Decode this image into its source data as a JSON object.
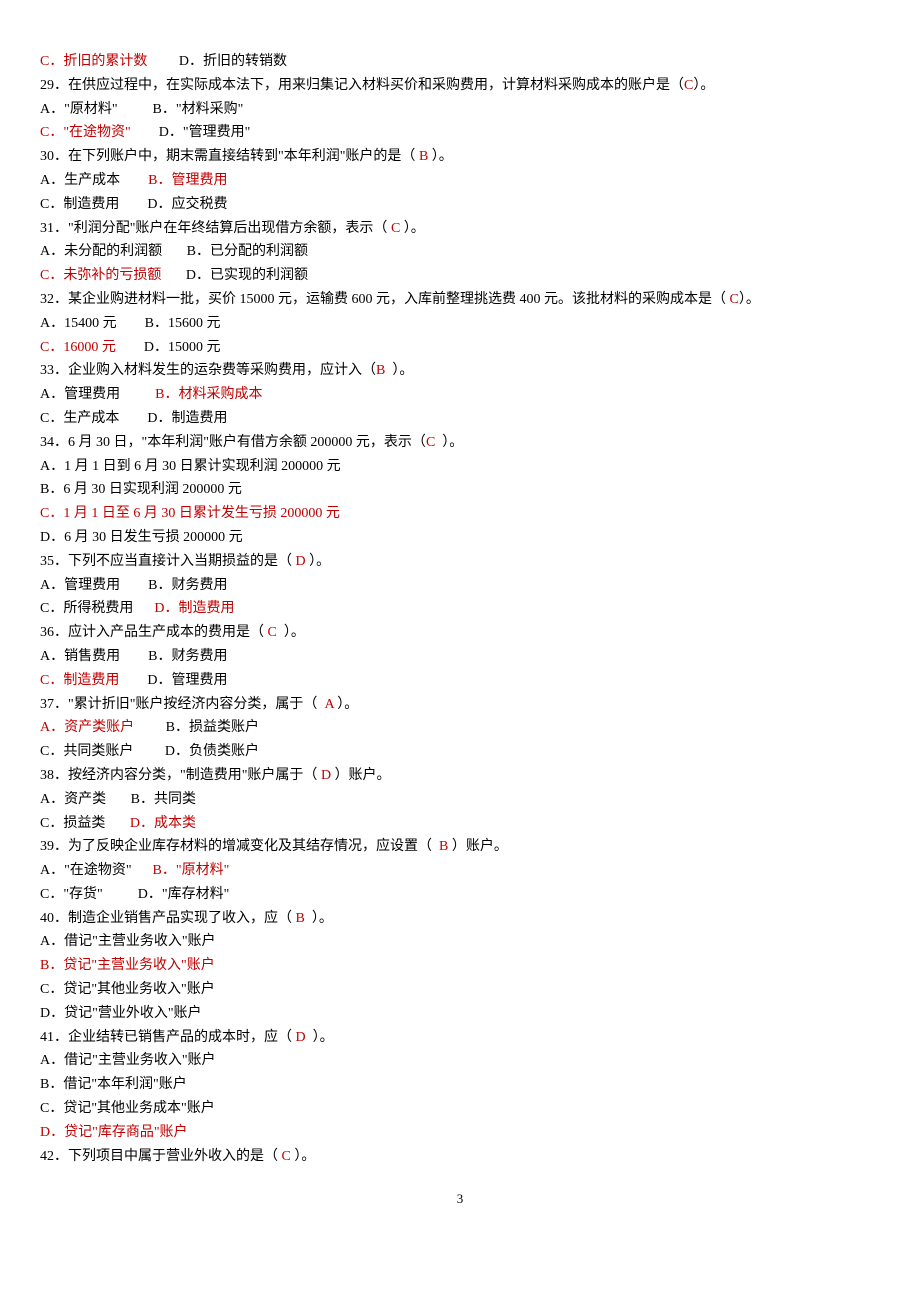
{
  "lines": [
    {
      "segments": [
        {
          "t": "C．折旧的累计数",
          "red": true
        },
        {
          "t": "         D．折旧的转销数",
          "red": false
        }
      ]
    },
    {
      "segments": [
        {
          "t": "29．在供应过程中，在实际成本法下，用来归集记入材料买价和采购费用，计算材料采购成本的账户是（",
          "red": false
        },
        {
          "t": "C",
          "red": true
        },
        {
          "t": "）。",
          "red": false
        }
      ]
    },
    {
      "segments": [
        {
          "t": "A．\"原材料\"          B．\"材料采购\"",
          "red": false
        }
      ]
    },
    {
      "segments": [
        {
          "t": "C．\"在途物资\"",
          "red": true
        },
        {
          "t": "        D．\"管理费用\"",
          "red": false
        }
      ]
    },
    {
      "segments": [
        {
          "t": "30．在下列账户中，期末需直接结转到\"本年利润\"账户的是（",
          "red": false
        },
        {
          "t": " B ",
          "red": true
        },
        {
          "t": "）。",
          "red": false
        }
      ]
    },
    {
      "segments": [
        {
          "t": "A．生产成本        ",
          "red": false
        },
        {
          "t": "B．管理费用",
          "red": true
        }
      ]
    },
    {
      "segments": [
        {
          "t": "C．制造费用        D．应交税费",
          "red": false
        }
      ]
    },
    {
      "segments": [
        {
          "t": "31．\"利润分配\"账户在年终结算后出现借方余额，表示（",
          "red": false
        },
        {
          "t": " C ",
          "red": true
        },
        {
          "t": "）。",
          "red": false
        }
      ]
    },
    {
      "segments": [
        {
          "t": "A．未分配的利润额       B．已分配的利润额",
          "red": false
        }
      ]
    },
    {
      "segments": [
        {
          "t": "C．未弥补的亏损额",
          "red": true
        },
        {
          "t": "       D．已实现的利润额",
          "red": false
        }
      ]
    },
    {
      "segments": [
        {
          "t": "32．某企业购进材料一批，买价 15000 元，运输费 600 元，入库前整理挑选费 400 元。该批材料的采购成本是（",
          "red": false
        },
        {
          "t": " C",
          "red": true
        },
        {
          "t": "）。",
          "red": false
        }
      ]
    },
    {
      "segments": [
        {
          "t": "A．15400 元        B．15600 元",
          "red": false
        }
      ]
    },
    {
      "segments": [
        {
          "t": "C．16000 元",
          "red": true
        },
        {
          "t": "        D．15000 元",
          "red": false
        }
      ]
    },
    {
      "segments": [
        {
          "t": "33．企业购入材料发生的运杂费等采购费用，应计入（",
          "red": false
        },
        {
          "t": "B",
          "red": true
        },
        {
          "t": "  ）。",
          "red": false
        }
      ]
    },
    {
      "segments": [
        {
          "t": "A．管理费用          ",
          "red": false
        },
        {
          "t": "B．材料采购成本",
          "red": true
        }
      ]
    },
    {
      "segments": [
        {
          "t": "C．生产成本        D．制造费用",
          "red": false
        }
      ]
    },
    {
      "segments": [
        {
          "t": "34．6 月 30 日，\"本年利润\"账户有借方余额 200000 元，表示（",
          "red": false
        },
        {
          "t": "C",
          "red": true
        },
        {
          "t": "  ）。",
          "red": false
        }
      ]
    },
    {
      "segments": [
        {
          "t": "A．1 月 1 日到 6 月 30 日累计实现利润 200000 元",
          "red": false
        }
      ]
    },
    {
      "segments": [
        {
          "t": "B．6 月 30 日实现利润 200000 元",
          "red": false
        }
      ]
    },
    {
      "segments": [
        {
          "t": "C．1 月 1 日至 6 月 30 日累计发生亏损 200000 元",
          "red": true
        }
      ]
    },
    {
      "segments": [
        {
          "t": "D．6 月 30 日发生亏损 200000 元",
          "red": false
        }
      ]
    },
    {
      "segments": [
        {
          "t": "35．下列不应当直接计入当期损益的是（",
          "red": false
        },
        {
          "t": " D ",
          "red": true
        },
        {
          "t": "）。",
          "red": false
        }
      ]
    },
    {
      "segments": [
        {
          "t": "A．管理费用        B．财务费用",
          "red": false
        }
      ]
    },
    {
      "segments": [
        {
          "t": "C．所得税费用      ",
          "red": false
        },
        {
          "t": "D．制造费用",
          "red": true
        }
      ]
    },
    {
      "segments": [
        {
          "t": "36．应计入产品生产成本的费用是（",
          "red": false
        },
        {
          "t": " C ",
          "red": true
        },
        {
          "t": " ）。",
          "red": false
        }
      ]
    },
    {
      "segments": [
        {
          "t": "A．销售费用        B．财务费用",
          "red": false
        }
      ]
    },
    {
      "segments": [
        {
          "t": "C．制造费用",
          "red": true
        },
        {
          "t": "        D．管理费用",
          "red": false
        }
      ]
    },
    {
      "segments": [
        {
          "t": "37．\"累计折旧\"账户按经济内容分类，属于（ ",
          "red": false
        },
        {
          "t": " A ",
          "red": true
        },
        {
          "t": "）。",
          "red": false
        }
      ]
    },
    {
      "segments": [
        {
          "t": "A．资产类账户",
          "red": true
        },
        {
          "t": "         B．损益类账户",
          "red": false
        }
      ]
    },
    {
      "segments": [
        {
          "t": "C．共同类账户         D．负债类账户",
          "red": false
        }
      ]
    },
    {
      "segments": [
        {
          "t": "38．按经济内容分类，\"制造费用\"账户属于（",
          "red": false
        },
        {
          "t": " D ",
          "red": true
        },
        {
          "t": "）账户。",
          "red": false
        }
      ]
    },
    {
      "segments": [
        {
          "t": "A．资产类       B．共同类",
          "red": false
        }
      ]
    },
    {
      "segments": [
        {
          "t": "C．损益类       ",
          "red": false
        },
        {
          "t": "D．成本类",
          "red": true
        }
      ]
    },
    {
      "segments": [
        {
          "t": "39．为了反映企业库存材料的增减变化及其结存情况，应设置（ ",
          "red": false
        },
        {
          "t": " B ",
          "red": true
        },
        {
          "t": "）账户。",
          "red": false
        }
      ]
    },
    {
      "segments": [
        {
          "t": "A．\"在途物资\"      ",
          "red": false
        },
        {
          "t": "B．\"原材料\"",
          "red": true
        }
      ]
    },
    {
      "segments": [
        {
          "t": "C．\"存货\"          D．\"库存材料\"",
          "red": false
        }
      ]
    },
    {
      "segments": [
        {
          "t": "40．制造企业销售产品实现了收入，应（",
          "red": false
        },
        {
          "t": " B ",
          "red": true
        },
        {
          "t": " ）。",
          "red": false
        }
      ]
    },
    {
      "segments": [
        {
          "t": "A．借记\"主营业务收入\"账户",
          "red": false
        }
      ]
    },
    {
      "segments": [
        {
          "t": "B．贷记\"主营业务收入\"账户",
          "red": true
        }
      ]
    },
    {
      "segments": [
        {
          "t": "C．贷记\"其他业务收入\"账户",
          "red": false
        }
      ]
    },
    {
      "segments": [
        {
          "t": "D．贷记\"营业外收入\"账户",
          "red": false
        }
      ]
    },
    {
      "segments": [
        {
          "t": "41．企业结转已销售产品的成本时，应（",
          "red": false
        },
        {
          "t": " D ",
          "red": true
        },
        {
          "t": " ）。",
          "red": false
        }
      ]
    },
    {
      "segments": [
        {
          "t": "A．借记\"主营业务收入\"账户",
          "red": false
        }
      ]
    },
    {
      "segments": [
        {
          "t": "B．借记\"本年利润\"账户",
          "red": false
        }
      ]
    },
    {
      "segments": [
        {
          "t": "C．贷记\"其他业务成本\"账户",
          "red": false
        }
      ]
    },
    {
      "segments": [
        {
          "t": "D．贷记\"库存商品\"账户",
          "red": true
        }
      ]
    },
    {
      "segments": [
        {
          "t": "42．下列项目中属于营业外收入的是（",
          "red": false
        },
        {
          "t": " C ",
          "red": true
        },
        {
          "t": "）。",
          "red": false
        }
      ]
    }
  ],
  "pageNumber": "3"
}
